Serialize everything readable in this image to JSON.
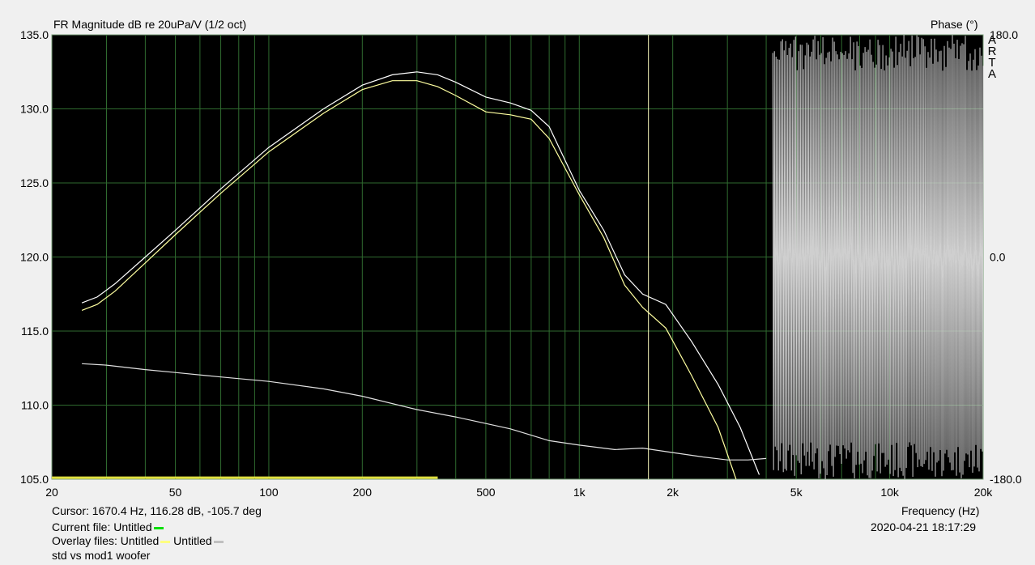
{
  "chart_data": {
    "type": "line",
    "title": "FR Magnitude dB re 20uPa/V (1/2 oct)",
    "right_axis_title": "Phase (°)",
    "watermark": [
      "A",
      "R",
      "T",
      "A"
    ],
    "xlabel": "Frequency (Hz)",
    "x_scale": "log",
    "xlim": [
      20,
      20000
    ],
    "ylim": [
      105,
      135
    ],
    "y2lim": [
      -180,
      180
    ],
    "grid": true,
    "x_ticks": [
      20,
      50,
      100,
      200,
      500,
      1000,
      2000,
      5000,
      10000,
      20000
    ],
    "x_tick_labels": [
      "20",
      "50",
      "100",
      "200",
      "500",
      "1k",
      "2k",
      "5k",
      "10k",
      "20k"
    ],
    "y_ticks": [
      105,
      110,
      115,
      120,
      125,
      130,
      135
    ],
    "y_tick_labels": [
      "105.0",
      "110.0",
      "115.0",
      "120.0",
      "125.0",
      "130.0",
      "135.0"
    ],
    "y2_ticks": [
      -180,
      0,
      180
    ],
    "y2_tick_labels": [
      "-180.0",
      "0.0",
      "180.0"
    ],
    "cursor_freq": 1670.4,
    "series": [
      {
        "color": "#ffffff",
        "x": [
          25,
          28,
          32,
          40,
          50,
          70,
          100,
          150,
          200,
          250,
          300,
          350,
          400,
          500,
          600,
          700,
          800,
          1000,
          1200,
          1400,
          1600,
          1900,
          2300,
          2800,
          3300,
          3800
        ],
        "y": [
          116.9,
          117.3,
          118.2,
          120.0,
          121.8,
          124.6,
          127.4,
          130.0,
          131.6,
          132.3,
          132.5,
          132.3,
          131.8,
          130.8,
          130.4,
          129.9,
          128.8,
          124.5,
          121.8,
          118.8,
          117.5,
          116.8,
          114.3,
          111.4,
          108.5,
          105.3
        ]
      },
      {
        "color": "#ffffa0",
        "x": [
          25,
          28,
          32,
          40,
          50,
          70,
          100,
          150,
          200,
          250,
          300,
          350,
          400,
          500,
          600,
          700,
          800,
          1000,
          1200,
          1400,
          1600,
          1900,
          2300,
          2800,
          3200
        ],
        "y": [
          116.4,
          116.8,
          117.7,
          119.6,
          121.5,
          124.3,
          127.1,
          129.7,
          131.3,
          131.9,
          131.9,
          131.5,
          130.9,
          129.8,
          129.6,
          129.3,
          128.0,
          124.2,
          121.3,
          118.1,
          116.6,
          115.2,
          112.0,
          108.5,
          105.0
        ]
      },
      {
        "color": "#e0e0e0",
        "x": [
          25,
          30,
          40,
          50,
          70,
          100,
          150,
          200,
          300,
          400,
          600,
          800,
          1000,
          1300,
          1600,
          2000,
          2500,
          3000,
          3500,
          4000
        ],
        "y": [
          112.8,
          112.7,
          112.4,
          112.2,
          111.9,
          111.6,
          111.1,
          110.6,
          109.7,
          109.2,
          108.4,
          107.6,
          107.3,
          107.0,
          107.1,
          106.8,
          106.5,
          106.3,
          106.3,
          106.4
        ]
      }
    ],
    "phase_band": {
      "x_start": 4200,
      "x_end": 20000,
      "range": [
        -180,
        180
      ]
    },
    "yellow_segment": {
      "x": [
        20,
        350
      ],
      "y": 105.1,
      "color": "#e0e040"
    }
  },
  "status": {
    "cursor": "Cursor: 1670.4 Hz, 116.28 dB, -105.7 deg",
    "current_file": "Current file: Untitled",
    "current_color": "#00e000",
    "overlay_label": "Overlay files: Untitled",
    "overlay_second": "Untitled",
    "overlay_color1": "#ffff80",
    "overlay_color2": "#c0c0c0",
    "description": "std vs mod1 woofer",
    "datetime": "2020-04-21  18:17:29"
  }
}
